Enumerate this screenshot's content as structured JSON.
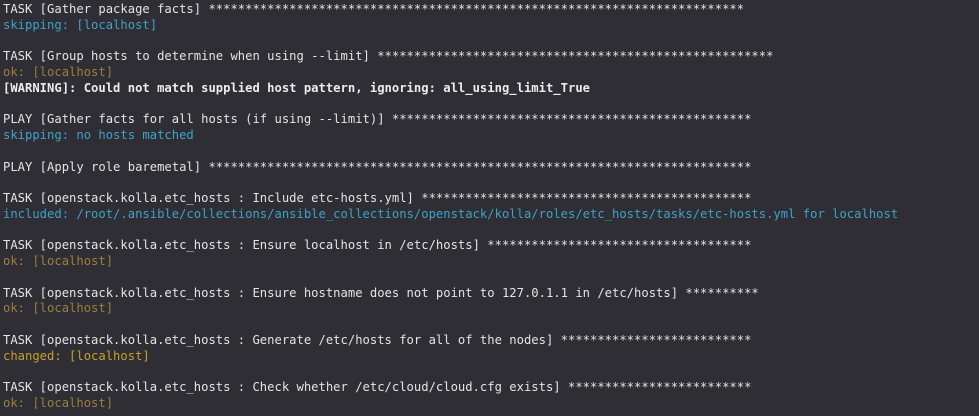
{
  "terminal": {
    "lines": [
      {
        "text": "TASK [Gather package facts] *************************************************************************",
        "kind": "header"
      },
      {
        "text": "skipping: [localhost]",
        "kind": "skip"
      },
      {
        "text": "",
        "kind": "blank"
      },
      {
        "text": "TASK [Group hosts to determine when using --limit] ******************************************************",
        "kind": "header"
      },
      {
        "text": "ok: [localhost]",
        "kind": "ok"
      },
      {
        "text": "[WARNING]: Could not match supplied host pattern, ignoring: all_using_limit_True",
        "kind": "warn"
      },
      {
        "text": "",
        "kind": "blank"
      },
      {
        "text": "PLAY [Gather facts for all hosts (if using --limit)] *************************************************",
        "kind": "header"
      },
      {
        "text": "skipping: no hosts matched",
        "kind": "skip"
      },
      {
        "text": "",
        "kind": "blank"
      },
      {
        "text": "PLAY [Apply role baremetal] **************************************************************************",
        "kind": "header"
      },
      {
        "text": "",
        "kind": "blank"
      },
      {
        "text": "TASK [openstack.kolla.etc_hosts : Include etc-hosts.yml] *********************************************",
        "kind": "header"
      },
      {
        "text": "included: /root/.ansible/collections/ansible_collections/openstack/kolla/roles/etc_hosts/tasks/etc-hosts.yml for localhost",
        "kind": "incl"
      },
      {
        "text": "",
        "kind": "blank"
      },
      {
        "text": "TASK [openstack.kolla.etc_hosts : Ensure localhost in /etc/hosts] ************************************",
        "kind": "header"
      },
      {
        "text": "ok: [localhost]",
        "kind": "ok"
      },
      {
        "text": "",
        "kind": "blank"
      },
      {
        "text": "TASK [openstack.kolla.etc_hosts : Ensure hostname does not point to 127.0.1.1 in /etc/hosts] **********",
        "kind": "header"
      },
      {
        "text": "ok: [localhost]",
        "kind": "ok"
      },
      {
        "text": "",
        "kind": "blank"
      },
      {
        "text": "TASK [openstack.kolla.etc_hosts : Generate /etc/hosts for all of the nodes] **************************",
        "kind": "header"
      },
      {
        "text": "changed: [localhost]",
        "kind": "changed"
      },
      {
        "text": "",
        "kind": "blank"
      },
      {
        "text": "TASK [openstack.kolla.etc_hosts : Check whether /etc/cloud/cloud.cfg exists] *************************",
        "kind": "header"
      },
      {
        "text": "ok: [localhost]",
        "kind": "ok"
      }
    ]
  },
  "colors": {
    "background": "#2e2e34",
    "header": "#e4e4e4",
    "skipping": "#3ea2c9",
    "ok": "#9c7f3d",
    "changed": "#c7a02b",
    "warning": "#ececec",
    "included": "#3ea2c9"
  }
}
